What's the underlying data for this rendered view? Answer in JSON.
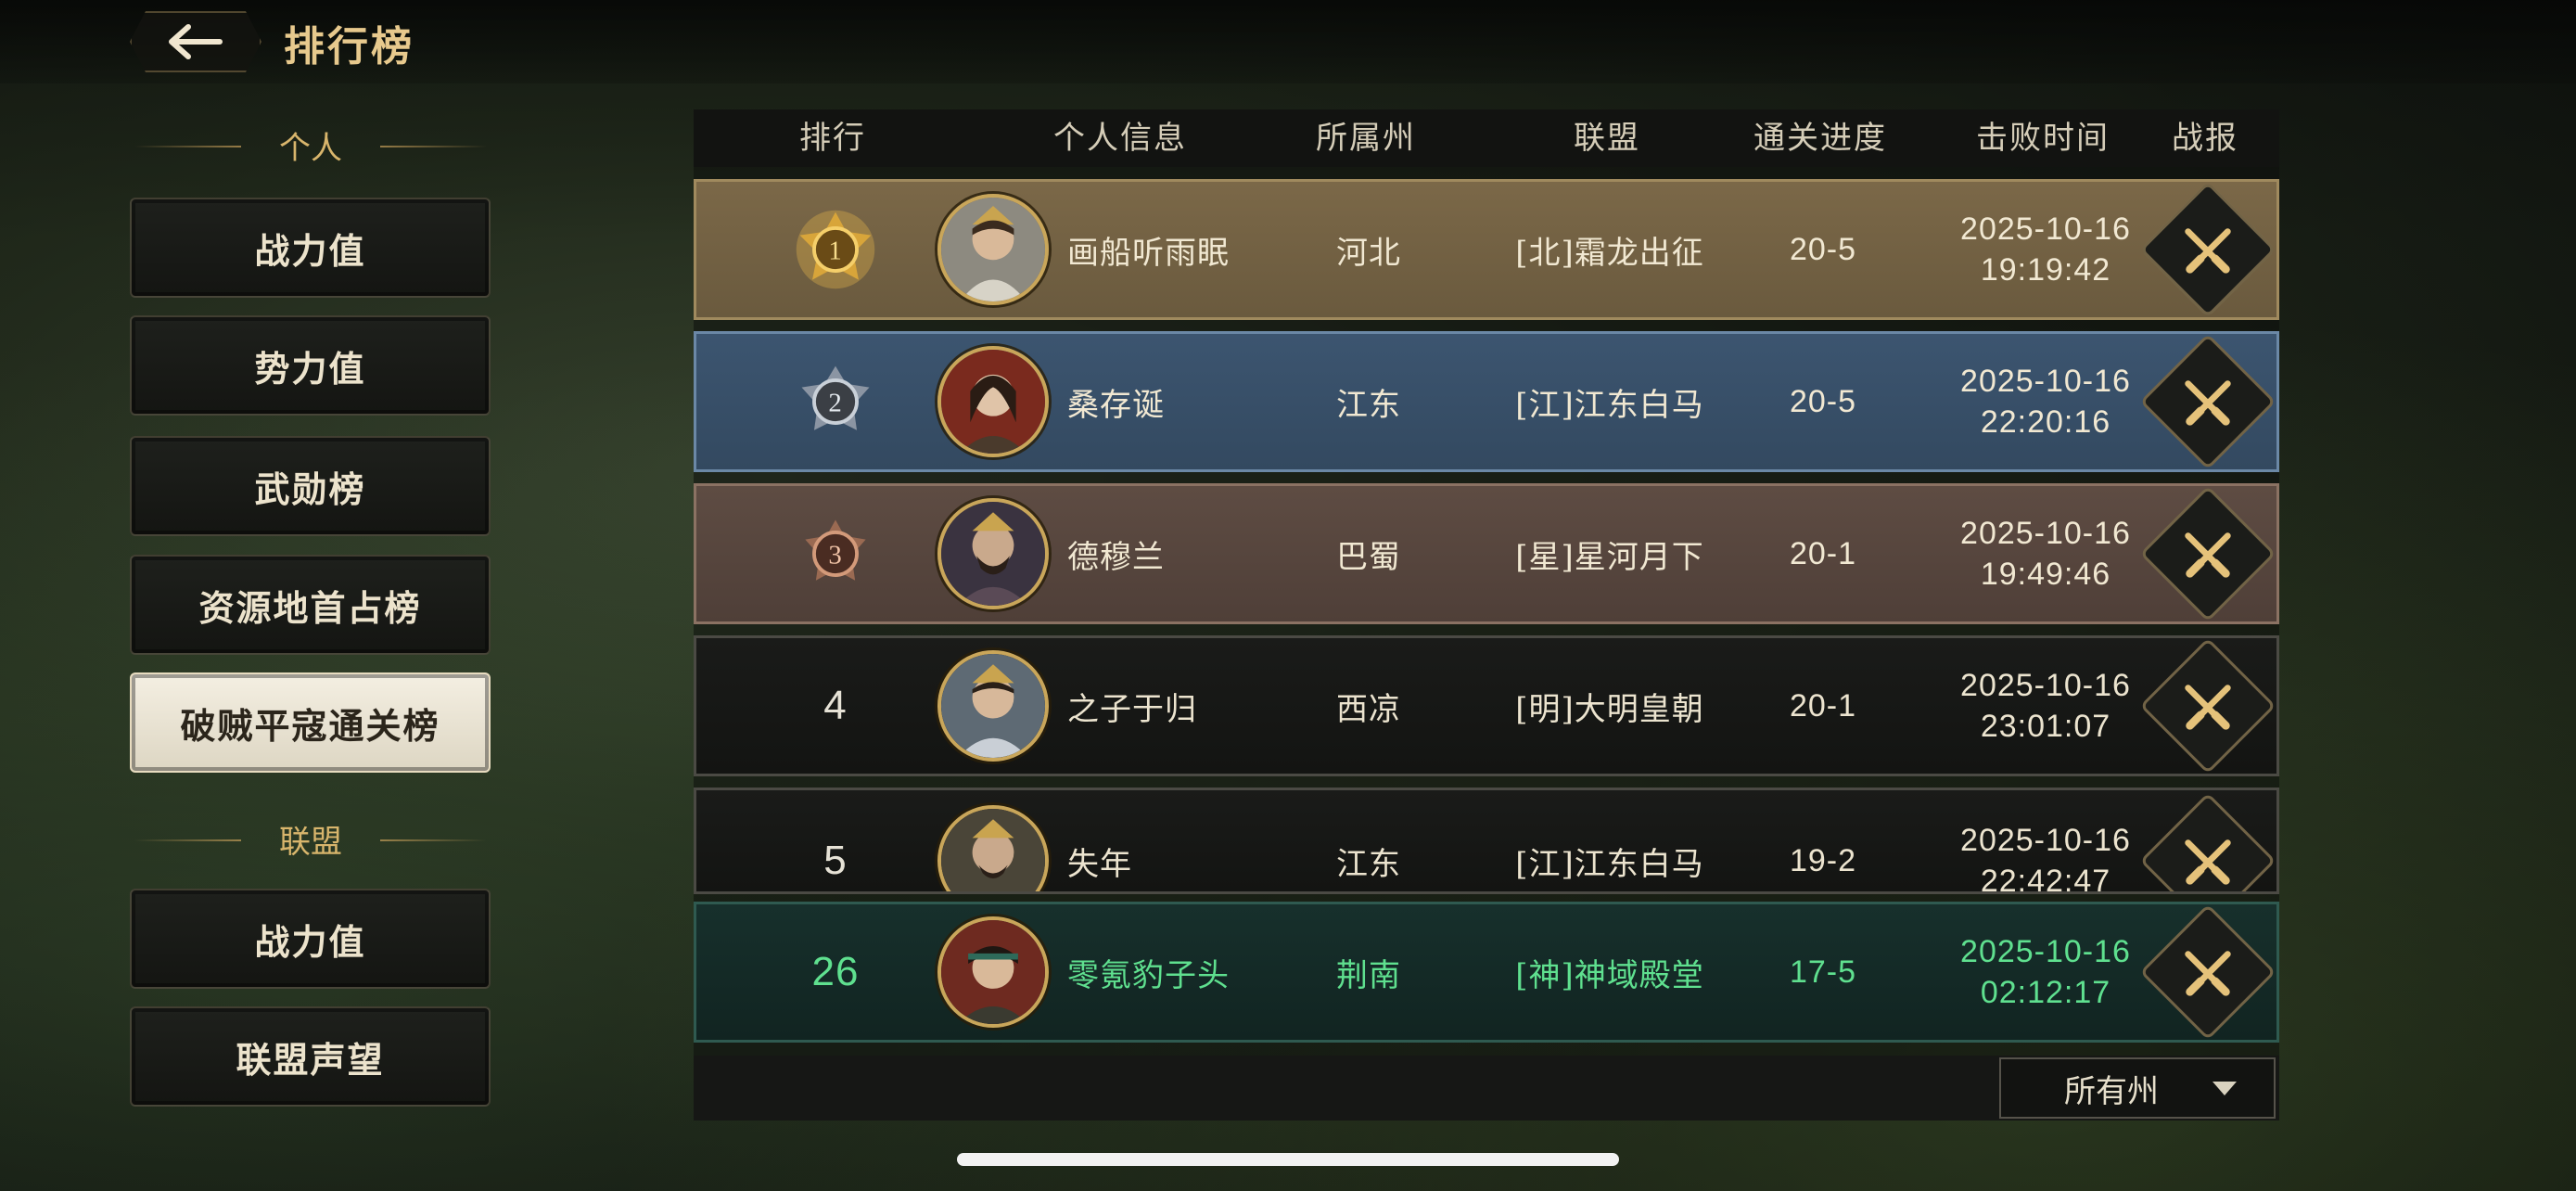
{
  "page": {
    "title": "排行榜"
  },
  "sidebar": {
    "personal_label": "个人",
    "personal_items": [
      {
        "label": "战力值"
      },
      {
        "label": "势力值"
      },
      {
        "label": "武勋榜"
      },
      {
        "label": "资源地首占榜"
      },
      {
        "label": "破贼平寇通关榜",
        "active": true
      }
    ],
    "alliance_label": "联盟",
    "alliance_items": [
      {
        "label": "战力值"
      },
      {
        "label": "联盟声望"
      }
    ]
  },
  "table": {
    "headers": {
      "rank": "排行",
      "info": "个人信息",
      "province": "所属州",
      "alliance": "联盟",
      "progress": "通关进度",
      "time": "击败时间",
      "report": "战报"
    },
    "rows": [
      {
        "rank": "1",
        "name": "画船听雨眠",
        "province": "河北",
        "alliance": "[北]霜龙出征",
        "progress": "20-5",
        "date": "2025-10-16",
        "time": "19:19:42"
      },
      {
        "rank": "2",
        "name": "桑存诞",
        "province": "江东",
        "alliance": "[江]江东白马",
        "progress": "20-5",
        "date": "2025-10-16",
        "time": "22:20:16"
      },
      {
        "rank": "3",
        "name": "德穆兰",
        "province": "巴蜀",
        "alliance": "[星]星河月下",
        "progress": "20-1",
        "date": "2025-10-16",
        "time": "19:49:46"
      },
      {
        "rank": "4",
        "name": "之子于归",
        "province": "西凉",
        "alliance": "[明]大明皇朝",
        "progress": "20-1",
        "date": "2025-10-16",
        "time": "23:01:07"
      },
      {
        "rank": "5",
        "name": "失年",
        "province": "江东",
        "alliance": "[江]江东白马",
        "progress": "19-2",
        "date": "2025-10-16",
        "time": "22:42:47"
      }
    ],
    "self_row": {
      "rank": "26",
      "name": "零氪豹子头",
      "province": "荆南",
      "alliance": "[神]神域殿堂",
      "progress": "17-5",
      "date": "2025-10-16",
      "time": "02:12:17"
    }
  },
  "filter": {
    "selected": "所有州"
  },
  "icons": {
    "back": "arrow-left-icon",
    "report": "crossed-swords-icon",
    "medal": "rank-medal-icon",
    "caret": "caret-down-icon"
  },
  "colors": {
    "gold": "#e7c98d",
    "self_green": "#5fe08f",
    "rank1": "#7b6848",
    "rank2": "#3c5570",
    "rank3": "#5e4c43"
  }
}
